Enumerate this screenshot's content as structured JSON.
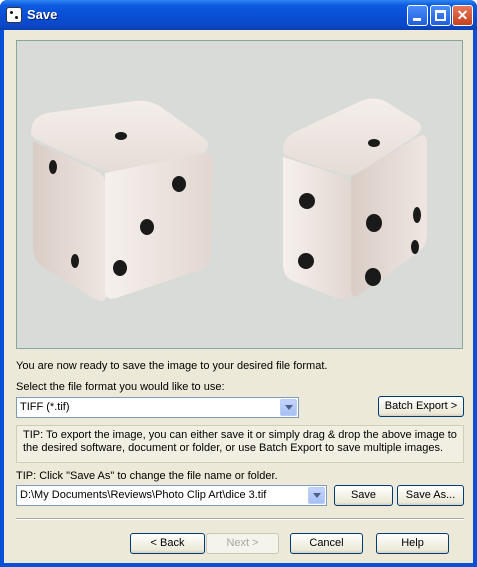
{
  "window": {
    "title": "Save"
  },
  "content": {
    "ready_text": "You are now ready to save the image to your desired file format.",
    "select_label": "Select the file format you would like to use:",
    "format_selected": "TIFF (*.tif)",
    "batch_export_label": "Batch Export >",
    "tip_text": "TIP: To export the image, you can either save it or simply drag & drop the above image to the desired software, document or folder, or use Batch Export to save multiple images.",
    "tip2_text": "TIP: Click \"Save As\" to change the file name or folder.",
    "path_value": "D:\\My Documents\\Reviews\\Photo Clip Art\\dice 3.tif",
    "save_label": "Save",
    "save_as_label": "Save As..."
  },
  "footer": {
    "back_label": "< Back",
    "next_label": "Next >",
    "cancel_label": "Cancel",
    "help_label": "Help"
  },
  "icons": {
    "app": "dice-icon",
    "minimize": "minimize-icon",
    "maximize": "maximize-icon",
    "close": "close-icon",
    "dropdown": "chevron-down-icon"
  },
  "colors": {
    "titlebar": "#0a4ed4",
    "client_bg": "#ece9d8",
    "close_button": "#c5401d"
  }
}
